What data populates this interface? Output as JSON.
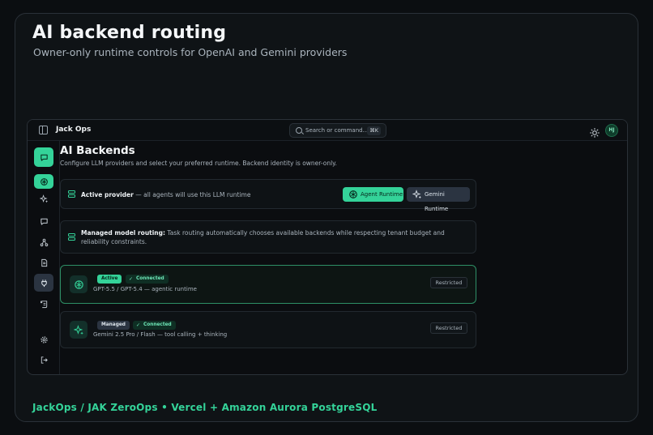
{
  "hero": {
    "title": "AI backend routing",
    "subtitle": "Owner-only runtime controls for OpenAI and Gemini providers"
  },
  "footer": "JackOps / JAK ZeroOps • Vercel + Amazon Aurora PostgreSQL",
  "topbar": {
    "brand": "Jack Ops",
    "search_placeholder": "Search or command...",
    "search_shortcut": "⌘K",
    "avatar_initials": "HJ"
  },
  "sidebar": {
    "items": [
      {
        "icon": "chat-icon",
        "active": true
      },
      {
        "icon": "openai-icon",
        "active": true
      },
      {
        "icon": "sparkle-icon"
      },
      {
        "icon": "message-icon"
      },
      {
        "icon": "workflow-icon"
      },
      {
        "icon": "document-icon"
      },
      {
        "icon": "plug-icon",
        "active": true
      },
      {
        "icon": "scroll-icon"
      },
      {
        "icon": "gear-icon"
      },
      {
        "icon": "logout-icon"
      }
    ]
  },
  "page": {
    "title": "AI Backends",
    "description": "Configure LLM providers and select your preferred runtime. Backend identity is owner-only."
  },
  "active_provider": {
    "label": "Active provider",
    "note": "— all agents will use this LLM runtime",
    "agent_button": "Agent Runtime",
    "gemini_button": "Gemini Runtime",
    "selected": "Agent Runtime"
  },
  "routing": {
    "label": "Managed model routing:",
    "text": "Task routing automatically chooses available backends while respecting tenant budget and reliability constraints."
  },
  "providers": [
    {
      "badge": "Active",
      "status": "Connected",
      "description": "GPT-5.5 / GPT-5.4 — agentic runtime",
      "access": "Restricted",
      "icon": "openai-icon"
    },
    {
      "badge": "Managed",
      "status": "Connected",
      "description": "Gemini 2.5 Pro / Flash — tool calling + thinking",
      "access": "Restricted",
      "icon": "sparkle-icon"
    }
  ],
  "colors": {
    "accent": "#34d399",
    "background": "#0b0e11",
    "selected_border": "#2e8f66"
  }
}
